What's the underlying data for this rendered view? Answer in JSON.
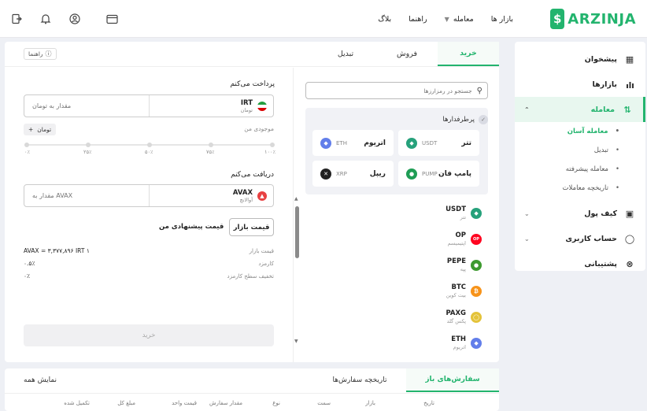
{
  "brand": {
    "name": "ARZINJA",
    "mark": "$",
    "color": "#23b46e"
  },
  "nav": {
    "markets": "بازار ها",
    "trade": "معامله",
    "guide": "راهنما",
    "blog": "بلاگ"
  },
  "sidebar": {
    "dashboard": "پیشخوان",
    "markets": "بازارها",
    "trade": "معامله",
    "sub": [
      "معامله آسان",
      "تبدیل",
      "معامله پیشرفته",
      "تاریخچه معاملات"
    ],
    "wallet": "کیف پول",
    "account": "حساب کاربری",
    "support": "پشتیبانی"
  },
  "tabs": {
    "buy": "خرید",
    "sell": "فروش",
    "convert": "تبدیل"
  },
  "help": "راهنما",
  "pay": {
    "title": "پرداخت می‌کنم",
    "currency_code": "IRT",
    "currency_name": "تومان",
    "placeholder": "مقدار به تومان",
    "balance_label": "موجودی من",
    "balance_btn": "تومان",
    "slider_ticks": [
      "۰٪",
      "۲۵٪",
      "۵۰٪",
      "۷۵٪",
      "۱۰۰٪"
    ]
  },
  "receive": {
    "title": "دریافت می‌کنم",
    "code": "AVAX",
    "name": "آوالانچ",
    "placeholder": "مقدار به AVAX"
  },
  "price_mode": {
    "market": "قیمت بازار",
    "offer": "قیمت پیشنهادی من"
  },
  "info": {
    "market_price_label": "قیمت بازار",
    "market_price_value": "۱ AVAX = ۳,۳۷۷,۸۹۶ IRT",
    "fee_label": "کارمزد",
    "fee_value": "۰.۵٪",
    "discount_label": "تخفیف سطح کارمزد",
    "discount_value": "۰٪"
  },
  "buy_button": "خرید",
  "search": {
    "placeholder": "جستجو در رمزارزها"
  },
  "popular": {
    "title": "پرطرفدارها",
    "items": [
      {
        "name": "تتر",
        "code": "USDT",
        "color": "#26a17b"
      },
      {
        "name": "اتریوم",
        "code": "ETH",
        "color": "#627eea"
      },
      {
        "name": "پامپ فان",
        "code": "PUMP",
        "color": "#1f9d55"
      },
      {
        "name": "ریپل",
        "code": "XRP",
        "color": "#222222"
      }
    ]
  },
  "coins": [
    {
      "code": "USDT",
      "name": "تتر",
      "color": "#26a17b"
    },
    {
      "code": "OP",
      "name": "اپتیمیسم",
      "color": "#ff0420"
    },
    {
      "code": "PEPE",
      "name": "پپه",
      "color": "#3d9a2f"
    },
    {
      "code": "BTC",
      "name": "بیت کوین",
      "color": "#f7931a"
    },
    {
      "code": "PAXG",
      "name": "پکس گلد",
      "color": "#e4c33a"
    },
    {
      "code": "ETH",
      "name": "اتریوم",
      "color": "#627eea"
    }
  ],
  "orders": {
    "tab_open": "سفارش‌های باز",
    "tab_history": "تاریخچه سفارش‌ها",
    "show_all": "نمایش همه",
    "columns": [
      "تاریخ",
      "بازار",
      "سمت",
      "نوع",
      "مقدار سفارش",
      "قیمت واحد",
      "مبلغ کل",
      "تکمیل شده"
    ]
  }
}
